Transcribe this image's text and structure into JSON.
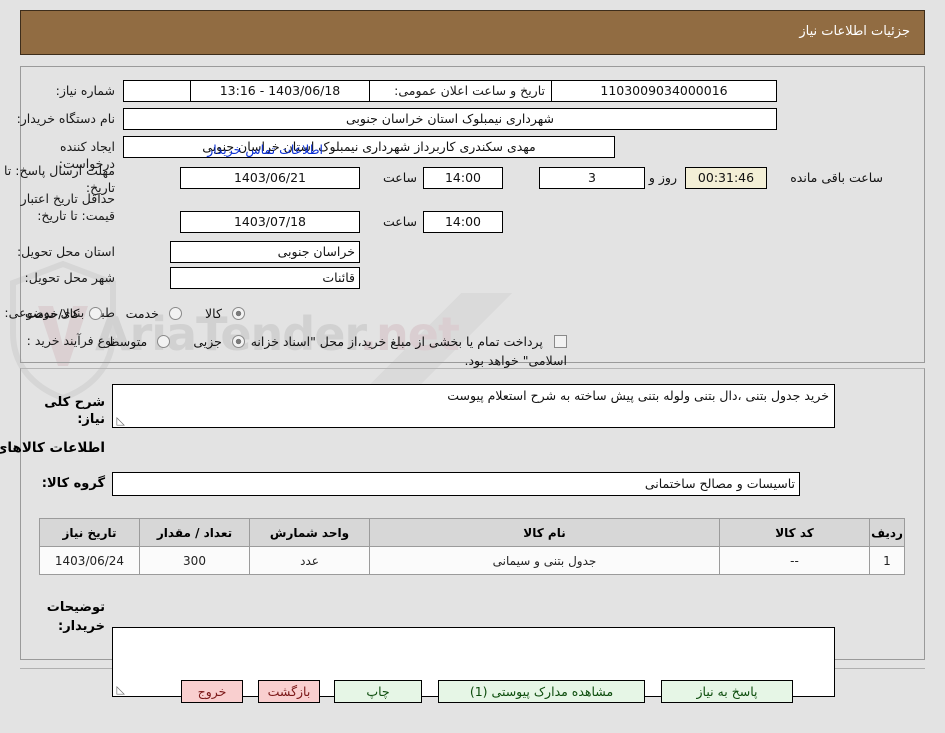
{
  "header": {
    "title": "جزئیات اطلاعات نیاز"
  },
  "watermark": {
    "text": "AriaTender",
    "suffix": ".net"
  },
  "form": {
    "need_number_label": "شماره نیاز:",
    "need_number_value": "1103009034000016",
    "public_announce_label": "تاریخ و ساعت اعلان عمومی:",
    "public_announce_value": "1403/06/18 - 13:16",
    "buyer_org_label": "نام دستگاه خریدار:",
    "buyer_org_value": "شهرداری نیمبلوک استان خراسان جنوبی",
    "requester_label": "ایجاد کننده درخواست:",
    "requester_value": "مهدی سکندری کاربرداز شهرداری نیمبلوک استان خراسان جنوبی",
    "contact_link": "اطلاعات تماس خریدار",
    "deadline_label": "مهلت ارسال پاسخ: تا تاریخ:",
    "deadline_date": "1403/06/21",
    "deadline_hour_label": "ساعت",
    "deadline_hour": "14:00",
    "remaining_days": "3",
    "remaining_days_label": "روز و",
    "remaining_timer": "00:31:46",
    "remaining_timer_label": "ساعت باقی مانده",
    "price_validity_label": "حداقل تاریخ اعتبار قیمت: تا تاریخ:",
    "price_validity_date": "1403/07/18",
    "price_validity_hour_label": "ساعت",
    "price_validity_hour": "14:00",
    "province_label": "استان محل تحویل:",
    "province_value": "خراسان جنوبی",
    "city_label": "شهر محل تحویل:",
    "city_value": "قائنات",
    "category_label": "طبقه بندی موضوعی:",
    "category_options": [
      {
        "label": "کالا",
        "selected": true
      },
      {
        "label": "خدمت",
        "selected": false
      },
      {
        "label": "کالا/خدمت",
        "selected": false
      }
    ],
    "process_label": "نوع فرآیند خرید :",
    "process_options": [
      {
        "label": "جزیی",
        "selected": true
      },
      {
        "label": "متوسط",
        "selected": false
      }
    ],
    "treasury_checkbox_checked": false,
    "treasury_text": "پرداخت تمام یا بخشی از مبلغ خرید،از محل \"اسناد خزانه اسلامی\" خواهد بود."
  },
  "body": {
    "need_desc_label": "شرح کلی نیاز:",
    "need_desc_value": "خرید جدول بتنی ،دال بتنی ولوله  بتنی پیش ساخته  به شرح استعلام پیوست",
    "goods_section_title": "اطلاعات کالاهای مورد نیاز",
    "goods_group_label": "گروه کالا:",
    "goods_group_value": "تاسیسات و مصالح ساختمانی",
    "buyer_notes_label": "توضیحات خریدار:",
    "buyer_notes_value": ""
  },
  "table": {
    "columns": [
      "ردیف",
      "کد کالا",
      "نام کالا",
      "واحد شمارش",
      "تعداد / مقدار",
      "تاریخ نیاز"
    ],
    "rows": [
      {
        "row_no": "1",
        "code": "--",
        "name": "جدول بتنی و سیمانی",
        "unit": "عدد",
        "qty": "300",
        "need_date": "1403/06/24"
      }
    ]
  },
  "footer": {
    "buttons": [
      {
        "label": "پاسخ به نیاز",
        "style": "green"
      },
      {
        "label": "مشاهده مدارک پیوستی (1)",
        "style": "green"
      },
      {
        "label": "چاپ",
        "style": "green"
      },
      {
        "label": "بازگشت",
        "style": "pink"
      },
      {
        "label": "خروج",
        "style": "pink"
      }
    ]
  },
  "colors": {
    "header_bar": "#916c42",
    "page_bg": "#e3e3e3",
    "link": "#0a2fd6",
    "timer_bg": "#f3efd6",
    "btn_green_bg": "#e6f6e6",
    "btn_pink_bg": "#f9cfcf"
  }
}
